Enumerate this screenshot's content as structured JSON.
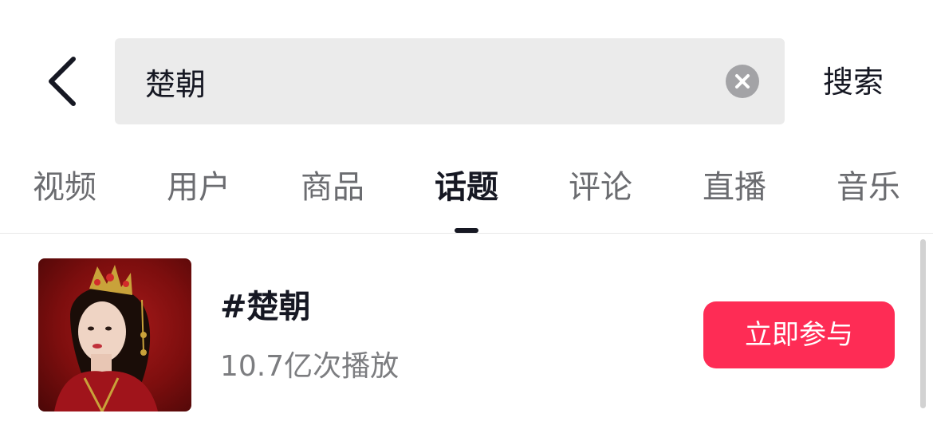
{
  "header": {
    "search_value": "楚朝",
    "search_button_label": "搜索"
  },
  "tabs": [
    {
      "label": "视频",
      "active": false
    },
    {
      "label": "用户",
      "active": false
    },
    {
      "label": "商品",
      "active": false
    },
    {
      "label": "话题",
      "active": true
    },
    {
      "label": "评论",
      "active": false
    },
    {
      "label": "直播",
      "active": false
    },
    {
      "label": "音乐",
      "active": false
    }
  ],
  "result": {
    "title": "#楚朝",
    "stats": "10.7亿次播放",
    "action_label": "立即参与"
  },
  "colors": {
    "accent": "#fe2c55",
    "text_primary": "#161823",
    "text_secondary": "#7c7d80",
    "search_bg": "#ebebeb"
  },
  "icons": {
    "back": "chevron-left-icon",
    "clear": "close-circle-icon"
  }
}
